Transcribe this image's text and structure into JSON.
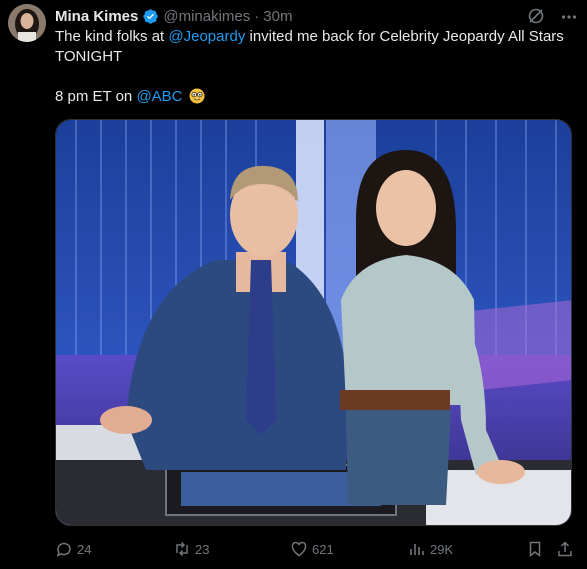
{
  "author": {
    "name": "Mina Kimes",
    "handle": "@minakimes",
    "separator": "·",
    "time": "30m",
    "verified_icon": "verified-badge-icon",
    "badge_color": "#1d9bf0"
  },
  "tweet": {
    "line1_pre": "The kind folks at ",
    "line1_mention": "@Jeopardy",
    "line1_post": " invited me back for Celebrity Jeopardy All Stars TONIGHT",
    "line2_pre": "8 pm ET on ",
    "line2_mention": "@ABC",
    "emoji": "nerd-face-emoji"
  },
  "actions": {
    "replies": "24",
    "reposts": "23",
    "likes": "621",
    "views": "29K"
  },
  "icons": [
    "grok-icon",
    "more-icon",
    "reply-icon",
    "repost-icon",
    "like-icon",
    "views-icon",
    "bookmark-icon",
    "share-icon"
  ],
  "colors": {
    "background": "#000000",
    "text": "#e7e9ea",
    "muted": "#71767b",
    "link": "#1d9bf0"
  }
}
